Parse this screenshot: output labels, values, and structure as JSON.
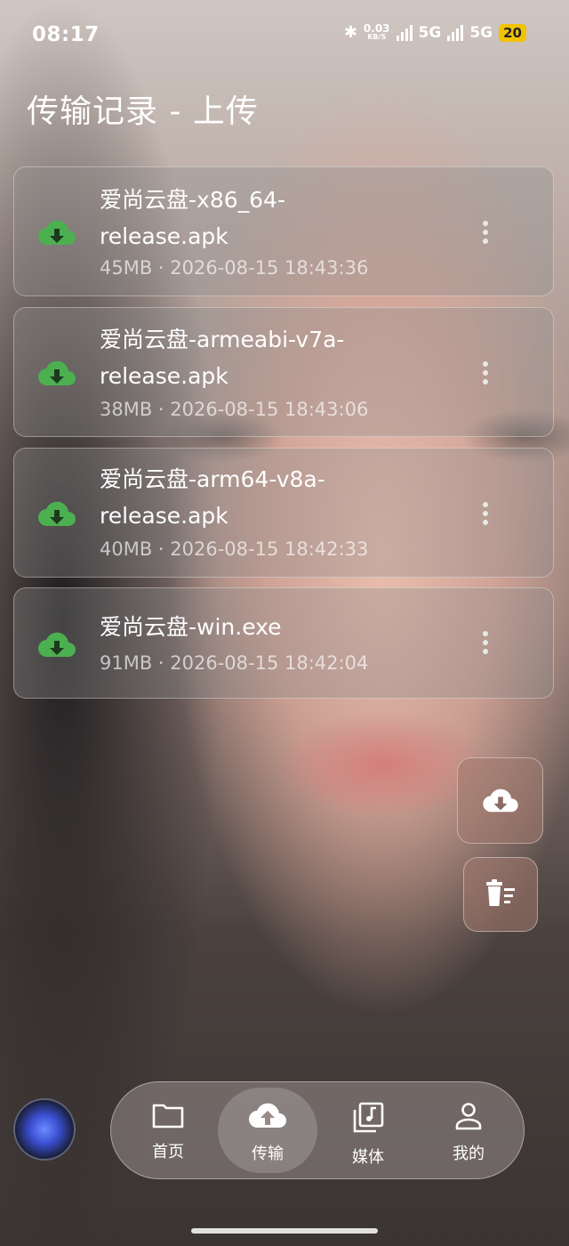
{
  "status_bar": {
    "time": "08:17",
    "net_speed": "0.03",
    "net_unit": "KB/S",
    "network1": "5G",
    "network2": "5G",
    "battery": "20"
  },
  "page_title": "传输记录 - 上传",
  "records": [
    {
      "name": "爱尚云盘-x86_64-release.apk",
      "meta": "45MB · 2026-08-15 18:43:36"
    },
    {
      "name": "爱尚云盘-armeabi-v7a-release.apk",
      "meta": "38MB · 2026-08-15 18:43:06"
    },
    {
      "name": "爱尚云盘-arm64-v8a-release.apk",
      "meta": "40MB · 2026-08-15 18:42:33"
    },
    {
      "name": "爱尚云盘-win.exe",
      "meta": "91MB · 2026-08-15 18:42:04"
    }
  ],
  "nav": {
    "items": [
      {
        "label": "首页",
        "icon": "folder-icon"
      },
      {
        "label": "传输",
        "icon": "cloud-upload-icon"
      },
      {
        "label": "媒体",
        "icon": "media-library-icon"
      },
      {
        "label": "我的",
        "icon": "person-icon"
      }
    ],
    "active": "传输"
  },
  "colors": {
    "accent_green": "#4caf50",
    "card_bg": "rgba(140,140,140,0.35)"
  }
}
